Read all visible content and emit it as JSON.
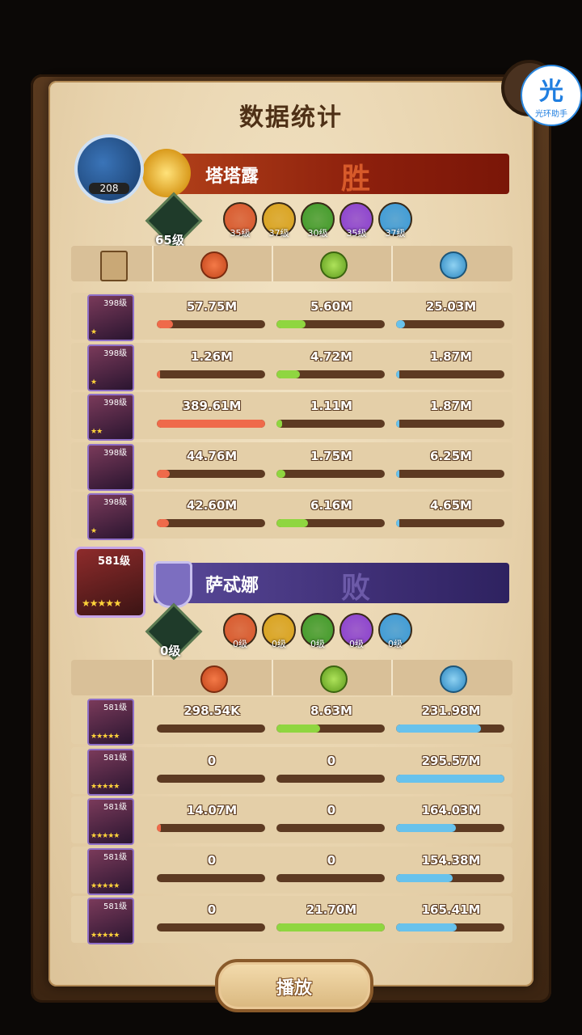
{
  "title": "数据统计",
  "helper": {
    "glyph": "光",
    "caption": "光环助手"
  },
  "team1": {
    "player_level": "208",
    "name": "塔塔露",
    "result": "胜",
    "tree_level": "65级",
    "factions": [
      {
        "name": "lightbearer",
        "level": "35级",
        "color": "#d8562a"
      },
      {
        "name": "mauler",
        "level": "37级",
        "color": "#d9a21c"
      },
      {
        "name": "wilder",
        "level": "30级",
        "color": "#3f9a28"
      },
      {
        "name": "graveborn",
        "level": "35级",
        "color": "#8a3fd0"
      },
      {
        "name": "celestial",
        "level": "37级",
        "color": "#3a9ad8"
      }
    ],
    "heroes": [
      {
        "level": "398级",
        "stars": "★",
        "damage": "57.75M",
        "heal": "5.60M",
        "defense": "25.03M",
        "damage_pct": 0.15,
        "heal_pct": 0.27,
        "defense_pct": 0.08
      },
      {
        "level": "398级",
        "stars": "★",
        "damage": "1.26M",
        "heal": "4.72M",
        "defense": "1.87M",
        "damage_pct": 0.005,
        "heal_pct": 0.22,
        "defense_pct": 0.006
      },
      {
        "level": "398级",
        "stars": "★★",
        "damage": "389.61M",
        "heal": "1.11M",
        "defense": "1.87M",
        "damage_pct": 1.0,
        "heal_pct": 0.05,
        "defense_pct": 0.006
      },
      {
        "level": "398级",
        "stars": "",
        "damage": "44.76M",
        "heal": "1.75M",
        "defense": "6.25M",
        "damage_pct": 0.12,
        "heal_pct": 0.08,
        "defense_pct": 0.02
      },
      {
        "level": "398级",
        "stars": "★",
        "damage": "42.60M",
        "heal": "6.16M",
        "defense": "4.65M",
        "damage_pct": 0.11,
        "heal_pct": 0.29,
        "defense_pct": 0.015
      }
    ]
  },
  "team2": {
    "player_level": "581级",
    "player_stars": "★★★★★",
    "name": "萨忒娜",
    "result": "败",
    "tree_level": "0级",
    "factions": [
      {
        "name": "lightbearer",
        "level": "0级",
        "color": "#d8562a"
      },
      {
        "name": "mauler",
        "level": "0级",
        "color": "#d9a21c"
      },
      {
        "name": "wilder",
        "level": "0级",
        "color": "#3f9a28"
      },
      {
        "name": "graveborn",
        "level": "0级",
        "color": "#8a3fd0"
      },
      {
        "name": "celestial",
        "level": "0级",
        "color": "#3a9ad8"
      }
    ],
    "heroes": [
      {
        "level": "581级",
        "stars": "★★★★★",
        "damage": "298.54K",
        "heal": "8.63M",
        "defense": "231.98M",
        "damage_pct": 0.0,
        "heal_pct": 0.4,
        "defense_pct": 0.78
      },
      {
        "level": "581级",
        "stars": "★★★★★",
        "damage": "0",
        "heal": "0",
        "defense": "295.57M",
        "damage_pct": 0.0,
        "heal_pct": 0.0,
        "defense_pct": 1.0
      },
      {
        "level": "581级",
        "stars": "★★★★★",
        "damage": "14.07M",
        "heal": "0",
        "defense": "164.03M",
        "damage_pct": 0.04,
        "heal_pct": 0.0,
        "defense_pct": 0.55
      },
      {
        "level": "581级",
        "stars": "★★★★★",
        "damage": "0",
        "heal": "0",
        "defense": "154.38M",
        "damage_pct": 0.0,
        "heal_pct": 0.0,
        "defense_pct": 0.52
      },
      {
        "level": "581级",
        "stars": "★★★★★",
        "damage": "0",
        "heal": "21.70M",
        "defense": "165.41M",
        "damage_pct": 0.0,
        "heal_pct": 1.0,
        "defense_pct": 0.56
      }
    ]
  },
  "play_button": "播放"
}
